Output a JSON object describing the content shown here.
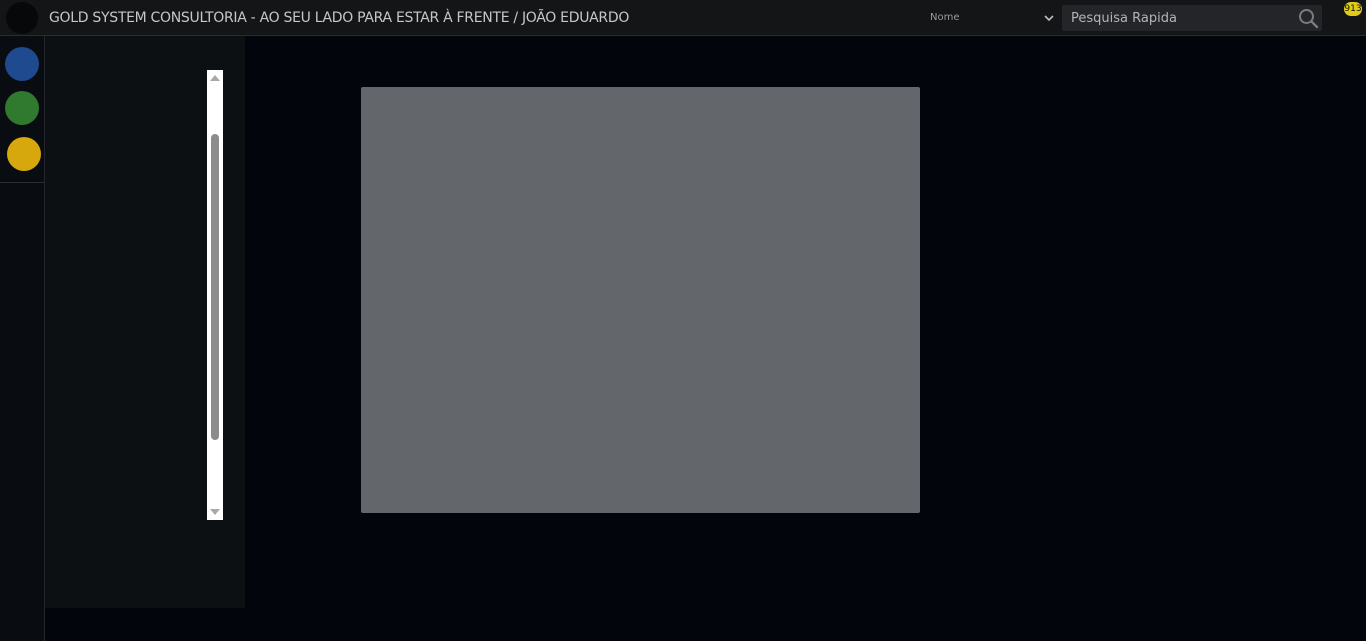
{
  "header": {
    "title": "GOLD SYSTEM CONSULTORIA - AO SEU LADO PARA ESTAR À FRENTE / JOÃO EDUARDO",
    "filter_select": {
      "selected": "Nome"
    },
    "search": {
      "placeholder": "Pesquisa Rapida",
      "value": ""
    },
    "notification_count": "913"
  },
  "left_rail": {
    "items": [
      {
        "name": "blue",
        "color": "#1f4a8f"
      },
      {
        "name": "green",
        "color": "#2f7a2f"
      },
      {
        "name": "yellow",
        "color": "#d6a80e"
      }
    ]
  },
  "colors": {
    "background": "#02050c",
    "topbar": "#141517",
    "content_panel": "#63666a",
    "badge": "#e2cc16"
  }
}
